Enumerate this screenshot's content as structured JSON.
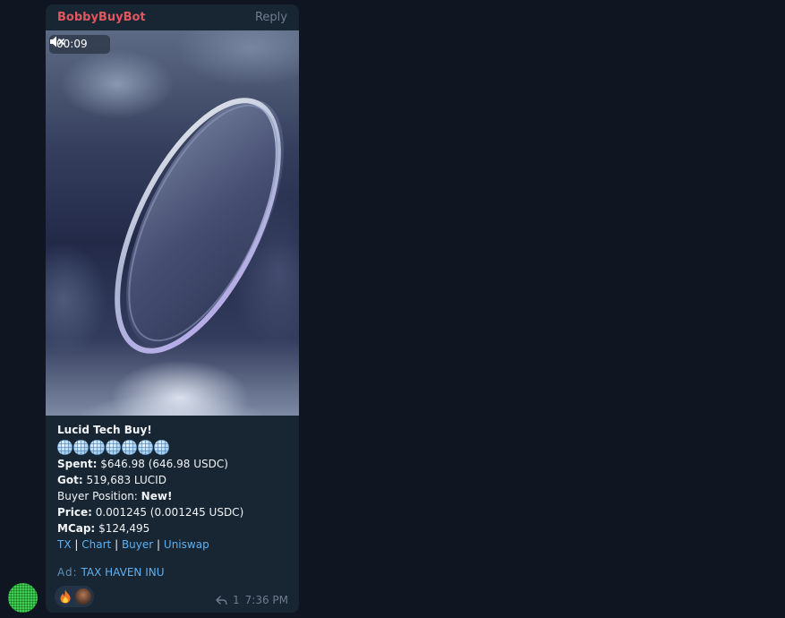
{
  "message": {
    "sender": "BobbyBuyBot",
    "reply_label": "Reply",
    "video": {
      "duration": "00:09",
      "muted": true
    },
    "title": "Lucid Tech Buy!",
    "globe_count": 7,
    "spent": {
      "label": "Spent:",
      "value": "$646.98 (646.98 USDC)"
    },
    "got": {
      "label": "Got:",
      "value": "519,683 LUCID"
    },
    "buyer_position": {
      "label": "Buyer Position:",
      "value": "New!"
    },
    "price": {
      "label": "Price:",
      "value": "0.001245 (0.001245 USDC)"
    },
    "mcap": {
      "label": "MCap:",
      "value": "$124,495"
    },
    "links": [
      "TX",
      "Chart",
      "Buyer",
      "Uniswap"
    ],
    "link_separator": "|",
    "ad": {
      "label": "Ad:",
      "text": "TAX HAVEN INU"
    },
    "reactions": [
      "fire-icon",
      "user-avatar-icon"
    ],
    "reply_count": "1",
    "time": "7:36 PM"
  },
  "colors": {
    "background": "#0f1621",
    "bubble": "#182533",
    "sender": "#e0575e",
    "link": "#5fb0f0",
    "muted_text": "#6e7d8c"
  }
}
